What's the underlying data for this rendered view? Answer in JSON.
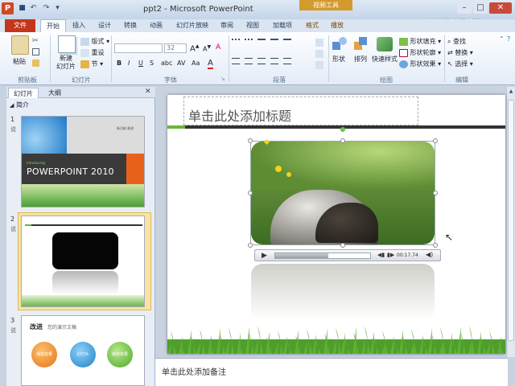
{
  "window": {
    "title": "ppt2 - Microsoft PowerPoint",
    "contextual_tab_group": "视频工具",
    "watermark": "搜狐视频",
    "app_icon": "P"
  },
  "tabs": [
    "文件",
    "开始",
    "插入",
    "设计",
    "转换",
    "动画",
    "幻灯片放映",
    "审阅",
    "视图",
    "加载项",
    "格式",
    "播放"
  ],
  "ribbon": {
    "clipboard": {
      "paste": "粘贴",
      "label": "剪贴板"
    },
    "slides": {
      "new_slide": "新建\n幻灯片",
      "layout": "版式",
      "reset": "重设",
      "section": "节",
      "label": "幻灯片"
    },
    "font": {
      "font_size": "32",
      "bold": "B",
      "italic": "I",
      "underline": "U",
      "strike": "S",
      "label": "字体"
    },
    "paragraph": {
      "label": "段落"
    },
    "drawing": {
      "shapes": "形状",
      "arrange": "排列",
      "quick_styles": "快速样式",
      "shape_fill": "形状填充",
      "shape_outline": "形状轮廓",
      "shape_effects": "形状效果",
      "label": "绘图"
    },
    "editing": {
      "find": "查找",
      "replace": "替换",
      "select": "选择",
      "label": "编辑"
    }
  },
  "left_panel": {
    "tabs": [
      "幻灯片",
      "大纲"
    ],
    "section_name": "简介",
    "slides": [
      {
        "num": "1",
        "sub": "说",
        "intro": "Introducing",
        "title": "POWERPOINT 2010",
        "tag": "新功能 概述"
      },
      {
        "num": "2",
        "sub": "说"
      },
      {
        "num": "3",
        "sub": "说",
        "title": "改进",
        "subtitle": "您的演示文稿",
        "circles": [
          "播放效果",
          "幻灯片",
          "播放效果"
        ]
      }
    ]
  },
  "slide": {
    "title_placeholder": "单击此处添加标题"
  },
  "video": {
    "time": "00:17.74",
    "progress": 0.56
  },
  "notes": {
    "placeholder": "单击此处添加备注"
  }
}
